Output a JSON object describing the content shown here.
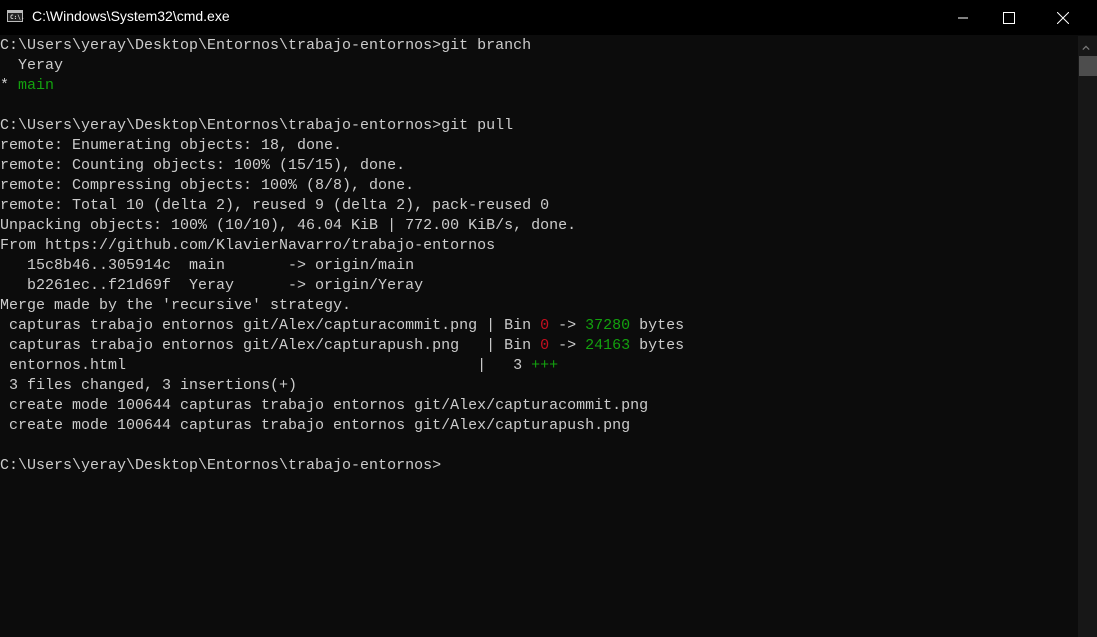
{
  "window": {
    "title": "C:\\Windows\\System32\\cmd.exe",
    "icon_text": "C:\\."
  },
  "colors": {
    "text": "#cccccc",
    "green": "#13a10e",
    "red": "#c50f1f",
    "background": "#0c0c0c"
  },
  "console": {
    "lines": [
      [
        {
          "t": "C:\\Users\\yeray\\Desktop\\Entornos\\trabajo-entornos>git branch"
        }
      ],
      [
        {
          "t": "  Yeray"
        }
      ],
      [
        {
          "t": "* "
        },
        {
          "t": "main",
          "c": "green"
        }
      ],
      [
        {
          "t": ""
        }
      ],
      [
        {
          "t": "C:\\Users\\yeray\\Desktop\\Entornos\\trabajo-entornos>git pull"
        }
      ],
      [
        {
          "t": "remote: Enumerating objects: 18, done."
        }
      ],
      [
        {
          "t": "remote: Counting objects: 100% (15/15), done."
        }
      ],
      [
        {
          "t": "remote: Compressing objects: 100% (8/8), done."
        }
      ],
      [
        {
          "t": "remote: Total 10 (delta 2), reused 9 (delta 2), pack-reused 0"
        }
      ],
      [
        {
          "t": "Unpacking objects: 100% (10/10), 46.04 KiB | 772.00 KiB/s, done."
        }
      ],
      [
        {
          "t": "From https://github.com/KlavierNavarro/trabajo-entornos"
        }
      ],
      [
        {
          "t": "   15c8b46..305914c  main       -> origin/main"
        }
      ],
      [
        {
          "t": "   b2261ec..f21d69f  Yeray      -> origin/Yeray"
        }
      ],
      [
        {
          "t": "Merge made by the 'recursive' strategy."
        }
      ],
      [
        {
          "t": " capturas trabajo entornos git/Alex/capturacommit.png | Bin "
        },
        {
          "t": "0",
          "c": "red"
        },
        {
          "t": " -> "
        },
        {
          "t": "37280",
          "c": "green"
        },
        {
          "t": " bytes"
        }
      ],
      [
        {
          "t": " capturas trabajo entornos git/Alex/capturapush.png   | Bin "
        },
        {
          "t": "0",
          "c": "red"
        },
        {
          "t": " -> "
        },
        {
          "t": "24163",
          "c": "green"
        },
        {
          "t": " bytes"
        }
      ],
      [
        {
          "t": " entornos.html                                       |   3 "
        },
        {
          "t": "+++",
          "c": "green"
        }
      ],
      [
        {
          "t": " 3 files changed, 3 insertions(+)"
        }
      ],
      [
        {
          "t": " create mode 100644 capturas trabajo entornos git/Alex/capturacommit.png"
        }
      ],
      [
        {
          "t": " create mode 100644 capturas trabajo entornos git/Alex/capturapush.png"
        }
      ],
      [
        {
          "t": ""
        }
      ],
      [
        {
          "t": "C:\\Users\\yeray\\Desktop\\Entornos\\trabajo-entornos>"
        }
      ]
    ]
  }
}
